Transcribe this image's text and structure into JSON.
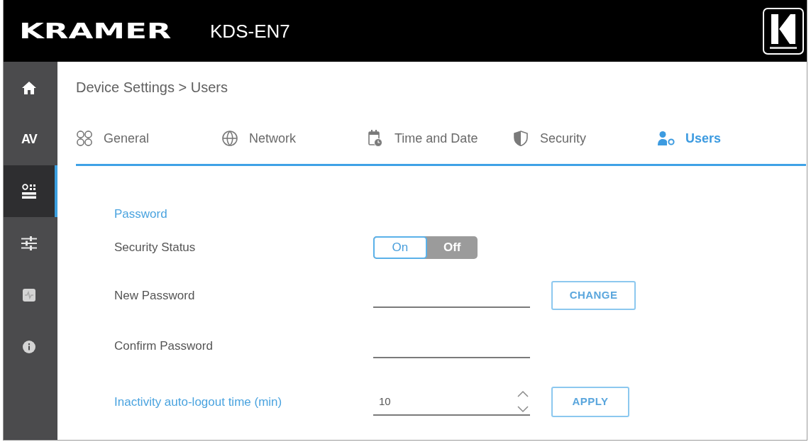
{
  "header": {
    "brand": "KRAMER",
    "model": "KDS-EN7"
  },
  "sidebar": {
    "items": [
      {
        "kind": "icon",
        "selected": false
      },
      {
        "kind": "text",
        "label": "AV",
        "selected": false
      },
      {
        "kind": "icon",
        "selected": true
      },
      {
        "kind": "icon",
        "selected": false
      },
      {
        "kind": "icon",
        "selected": false
      },
      {
        "kind": "icon",
        "selected": false
      }
    ]
  },
  "breadcrumb": "Device Settings > Users",
  "tabs": [
    {
      "label": "General",
      "selected": false
    },
    {
      "label": "Network",
      "selected": false
    },
    {
      "label": "Time and Date",
      "selected": false
    },
    {
      "label": "Security",
      "selected": false
    },
    {
      "label": "Users",
      "selected": true
    }
  ],
  "form": {
    "title": "Password",
    "rows": [
      {
        "kind": "toggle",
        "label": "Security Status",
        "options": [
          {
            "label": "On",
            "selected": true
          },
          {
            "label": "Off",
            "selected": false
          }
        ]
      },
      {
        "kind": "password",
        "label": "New Password",
        "button": "CHANGE"
      },
      {
        "kind": "password",
        "label": "Confirm Password"
      },
      {
        "kind": "number",
        "label": "Inactivity auto-logout time (min)",
        "value": "10",
        "button": "APPLY"
      }
    ]
  }
}
